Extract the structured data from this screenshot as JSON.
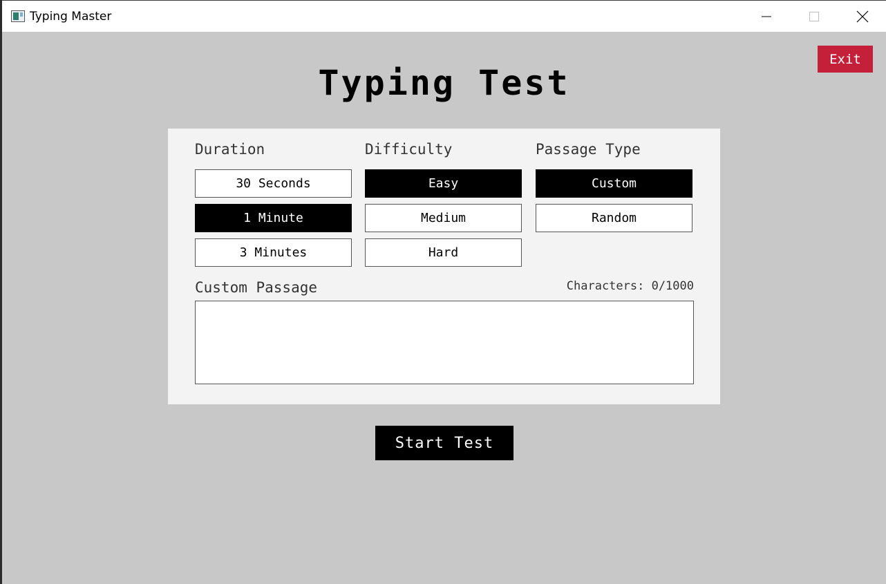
{
  "window": {
    "title": "Typing Master",
    "icons": {
      "app": "app-icon",
      "minimize": "minimize-icon",
      "maximize": "maximize-icon",
      "close": "close-icon"
    }
  },
  "header": {
    "title": "Typing Test",
    "exit_label": "Exit",
    "exit_color": "#c4203a"
  },
  "settings": {
    "duration": {
      "label": "Duration",
      "options": [
        "30 Seconds",
        "1 Minute",
        "3 Minutes"
      ],
      "selected": "1 Minute"
    },
    "difficulty": {
      "label": "Difficulty",
      "options": [
        "Easy",
        "Medium",
        "Hard"
      ],
      "selected": "Easy"
    },
    "passage_type": {
      "label": "Passage Type",
      "options": [
        "Custom",
        "Random"
      ],
      "selected": "Custom"
    }
  },
  "custom_passage": {
    "label": "Custom Passage",
    "char_count": "Characters: 0/1000",
    "value": ""
  },
  "actions": {
    "start_label": "Start Test"
  }
}
